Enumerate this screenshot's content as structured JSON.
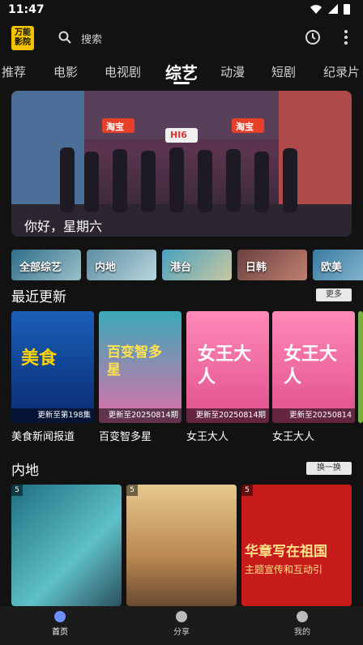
{
  "status": {
    "time": "11:47"
  },
  "app": {
    "logo_text": "万能影院"
  },
  "search": {
    "placeholder": "搜索"
  },
  "tabs": [
    "推荐",
    "电影",
    "电视剧",
    "综艺",
    "动漫",
    "短剧",
    "纪录片"
  ],
  "active_tab": "综艺",
  "banner": {
    "caption": "你好，星期六",
    "logos": [
      "淘宝",
      "HI6",
      "淘宝"
    ]
  },
  "chips": [
    "全部综艺",
    "内地",
    "港台",
    "日韩",
    "欧美"
  ],
  "recent": {
    "title": "最近更新",
    "more_label": "更多",
    "items": [
      {
        "name": "美食新闻报道",
        "update": "更新至第198集",
        "art": "美食"
      },
      {
        "name": "百变智多星",
        "update": "更新至20250814期",
        "art": "百变智多星"
      },
      {
        "name": "女王大人",
        "update": "更新至20250814期",
        "art": "女王大人"
      },
      {
        "name": "女王大人",
        "update": "更新至20250814",
        "art": "女王大人"
      }
    ]
  },
  "mainland": {
    "title": "内地",
    "refresh_label": "换一换",
    "items": [
      {
        "score": "5"
      },
      {
        "score": "5"
      },
      {
        "score": "5",
        "art": "华章写在祖国",
        "sub": "主题宣传和互动引"
      }
    ]
  },
  "bottom_nav": [
    {
      "label": "首页",
      "icon": "home-icon"
    },
    {
      "label": "分享",
      "icon": "share-icon"
    },
    {
      "label": "我的",
      "icon": "profile-icon"
    }
  ]
}
